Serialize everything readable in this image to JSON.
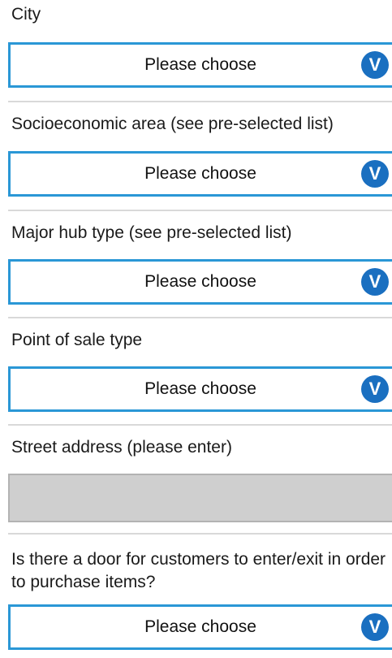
{
  "fields": [
    {
      "label": "City",
      "value": "Please choose"
    },
    {
      "label": "Socioeconomic area (see pre-selected list)",
      "value": "Please choose"
    },
    {
      "label": "Major hub type (see pre-selected list)",
      "value": "Please choose"
    },
    {
      "label": "Point of sale type",
      "value": "Please choose"
    }
  ],
  "street_address": {
    "label": "Street address (please enter)",
    "value": ""
  },
  "door_question": {
    "label": "Is there a door for customers to enter/exit in order to purchase items?",
    "value": "Please choose"
  },
  "icons": {
    "dropdown": "chevron-down-icon",
    "dropdown_glyph": "V"
  },
  "colors": {
    "select_border": "#2a97d6",
    "icon_background": "#1a6fc0",
    "text_input_background": "#cfcfcf"
  }
}
